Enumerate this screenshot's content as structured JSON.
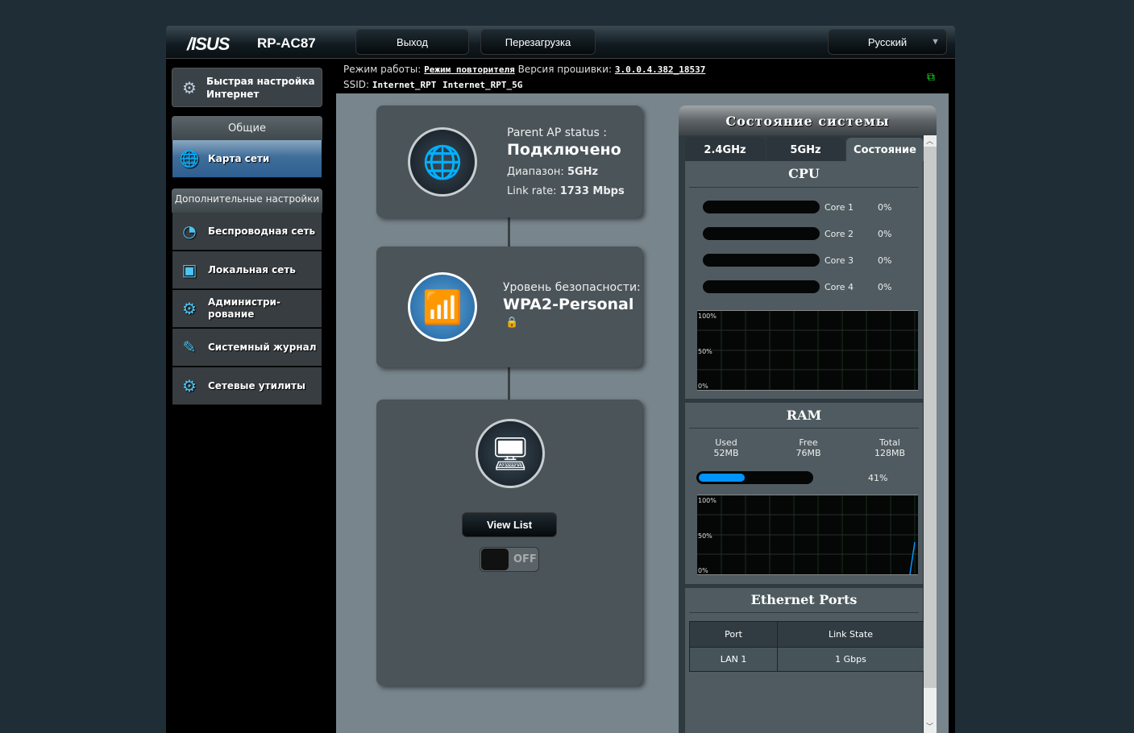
{
  "header": {
    "brand": "/ISUS",
    "model": "RP-AC87",
    "logout": "Выход",
    "reboot": "Перезагрузка",
    "language": "Русский",
    "mode_label": "Режим работы:",
    "mode_value": "Режим повторителя",
    "fw_label": "Версия прошивки:",
    "fw_value": "3.0.0.4.382_18537",
    "ssid_label": "SSID:",
    "ssid_24": "Internet_RPT",
    "ssid_5": "Internet_RPT_5G"
  },
  "sidebar": {
    "quick_setup": "Быстрая настройка Интернет",
    "general": "Общие",
    "advanced": "Дополнительные настройки",
    "items": [
      {
        "label": "Карта сети",
        "icon": "globe-pin-icon"
      },
      {
        "label": "Беспроводная сеть",
        "icon": "wireless-icon"
      },
      {
        "label": "Локальная сеть",
        "icon": "lan-icon"
      },
      {
        "label": "Администри-рование",
        "icon": "admin-gear-icon"
      },
      {
        "label": "Системный журнал",
        "icon": "log-icon"
      },
      {
        "label": "Сетевые утилиты",
        "icon": "tools-icon"
      }
    ]
  },
  "map": {
    "parent_label": "Parent AP status :",
    "parent_status": "Подключено",
    "band_label": "Диапазон:",
    "band": "5GHz",
    "rate_label": "Link rate:",
    "rate": "1733 Mbps",
    "security_label": "Уровень безопасности:",
    "security": "WPA2-Personal",
    "view_list": "View List",
    "toggle": "OFF"
  },
  "status": {
    "title": "Состояние системы",
    "tabs": [
      "2.4GHz",
      "5GHz",
      "Состояние"
    ],
    "cpu_title": "CPU",
    "cores": [
      {
        "name": "Core 1",
        "value": "0%"
      },
      {
        "name": "Core 2",
        "value": "0%"
      },
      {
        "name": "Core 3",
        "value": "0%"
      },
      {
        "name": "Core 4",
        "value": "0%"
      }
    ],
    "graph_labels": [
      "100%",
      "50%",
      "0%"
    ],
    "ram_title": "RAM",
    "used_label": "Used",
    "used": "52MB",
    "free_label": "Free",
    "free": "76MB",
    "total_label": "Total",
    "total": "128MB",
    "ram_percent": "41%",
    "ram_fill": 41,
    "eth_title": "Ethernet Ports",
    "eth_headers": [
      "Port",
      "Link State"
    ],
    "eth_rows": [
      [
        "LAN 1",
        "1 Gbps"
      ]
    ]
  },
  "colors": {
    "accent": "#0094ff",
    "status_icon": "#22dd22"
  }
}
